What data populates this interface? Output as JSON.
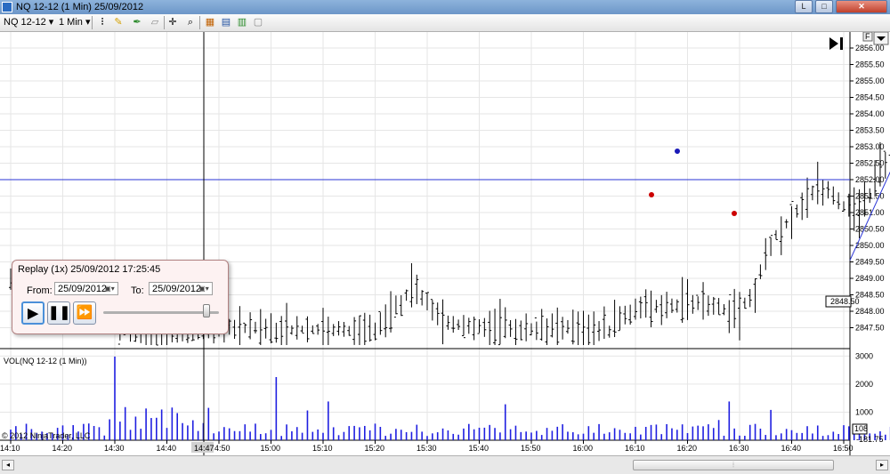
{
  "window": {
    "title": "NQ 12-12 (1 Min)  25/09/2012",
    "min_label": "L",
    "max_label": "□",
    "close_label": "✕"
  },
  "toolbar": {
    "instrument": "NQ 12-12",
    "interval": "1 Min",
    "icons": [
      "bar-style-icon",
      "draw-pencil-icon",
      "pen-icon",
      "eraser-icon",
      "crosshair-icon",
      "zoom-icon",
      "indicators-icon",
      "strategies-icon",
      "templates-icon",
      "properties-icon"
    ]
  },
  "chart": {
    "price_axis": [
      "2856.00",
      "2855.50",
      "2855.00",
      "2854.50",
      "2854.00",
      "2853.50",
      "2853.00",
      "2852.50",
      "2852.00",
      "2851.50",
      "2851.00",
      "2850.50",
      "2850.00",
      "2849.50",
      "2849.00",
      "2848.50",
      "2848.00",
      "2847.50"
    ],
    "last_price": "2848.50",
    "volume_axis": [
      "3000",
      "2000",
      "1000"
    ],
    "volume_last": "108",
    "volume_neg": "-181.75",
    "volume_label": "VOL(NQ 12-12 (1 Min))",
    "copyright": "© 2012 NinjaTrader, LLC",
    "time_axis": [
      "14:10",
      "14:20",
      "14:30",
      "14:40",
      "4:50",
      "15:00",
      "15:10",
      "15:20",
      "15:30",
      "15:40",
      "15:50",
      "16:00",
      "16:10",
      "16:20",
      "16:30",
      "16:40",
      "16:50"
    ],
    "crosshair_time": "14:47",
    "horizontal_line_price": 2852.0,
    "colors": {
      "line": "#2a35d6",
      "volume": "#1e1ee0",
      "marker_red": "#cc0000",
      "marker_blue": "#1a1ab8"
    }
  },
  "chart_data": {
    "type": "bar",
    "title": "NQ 12-12 (1 Min) 25/09/2012",
    "ylim": [
      2847.25,
      2856.25
    ],
    "volume_ylim": [
      0,
      3200
    ]
  },
  "replay": {
    "title": "Replay (1x) 25/09/2012 17:25:45",
    "from_label": "From:",
    "from_value": "25/09/2012",
    "to_label": "To:",
    "to_value": "25/09/2012"
  }
}
